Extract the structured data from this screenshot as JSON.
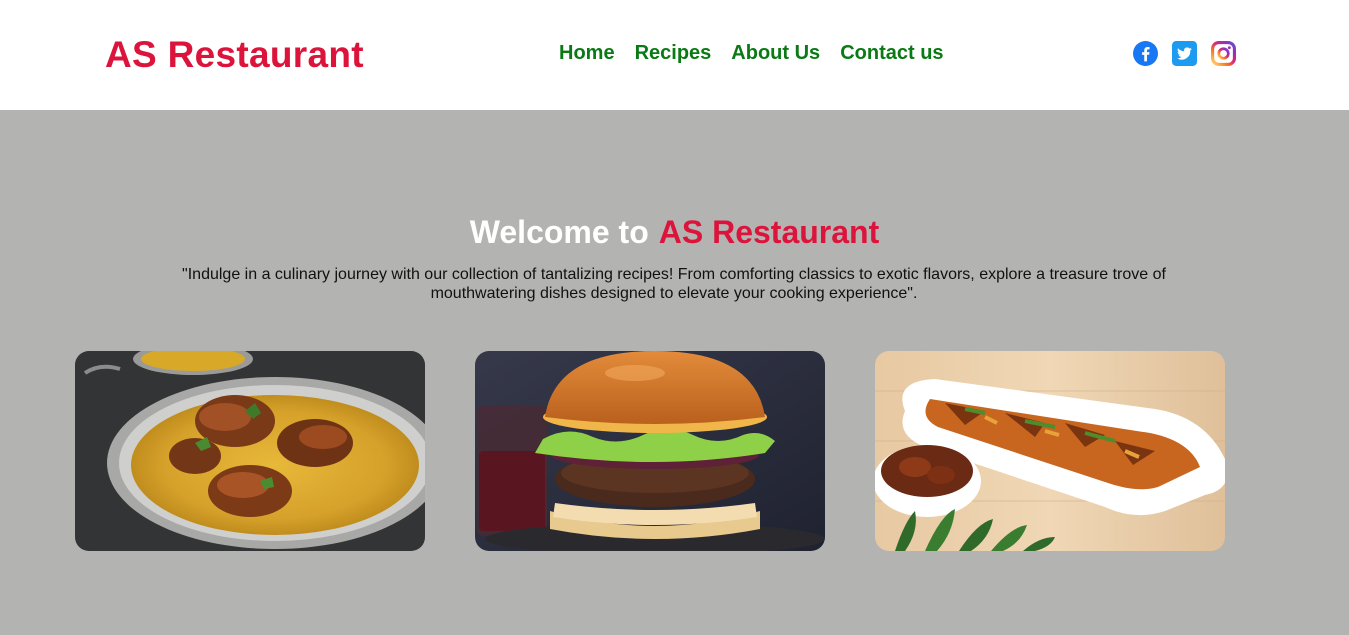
{
  "header": {
    "logo": "AS Restaurant",
    "nav": [
      {
        "label": "Home"
      },
      {
        "label": "Recipes"
      },
      {
        "label": "About Us"
      },
      {
        "label": "Contact us"
      }
    ],
    "social": [
      {
        "icon": "facebook-icon",
        "color": "#1877f2"
      },
      {
        "icon": "twitter-icon",
        "color": "#1d9bf0"
      },
      {
        "icon": "instagram-icon",
        "color": "#dd2a7b"
      }
    ]
  },
  "hero": {
    "welcome": "Welcome to",
    "brand": "AS Restaurant",
    "tagline": "\"Indulge in a culinary journey with our collection of tantalizing recipes! From comforting classics to exotic flavors, explore a treasure trove of mouthwatering dishes designed to elevate your cooking experience\"."
  },
  "colors": {
    "brand": "#dc143c",
    "nav": "#0a7a14",
    "background": "#b3b3b2"
  }
}
